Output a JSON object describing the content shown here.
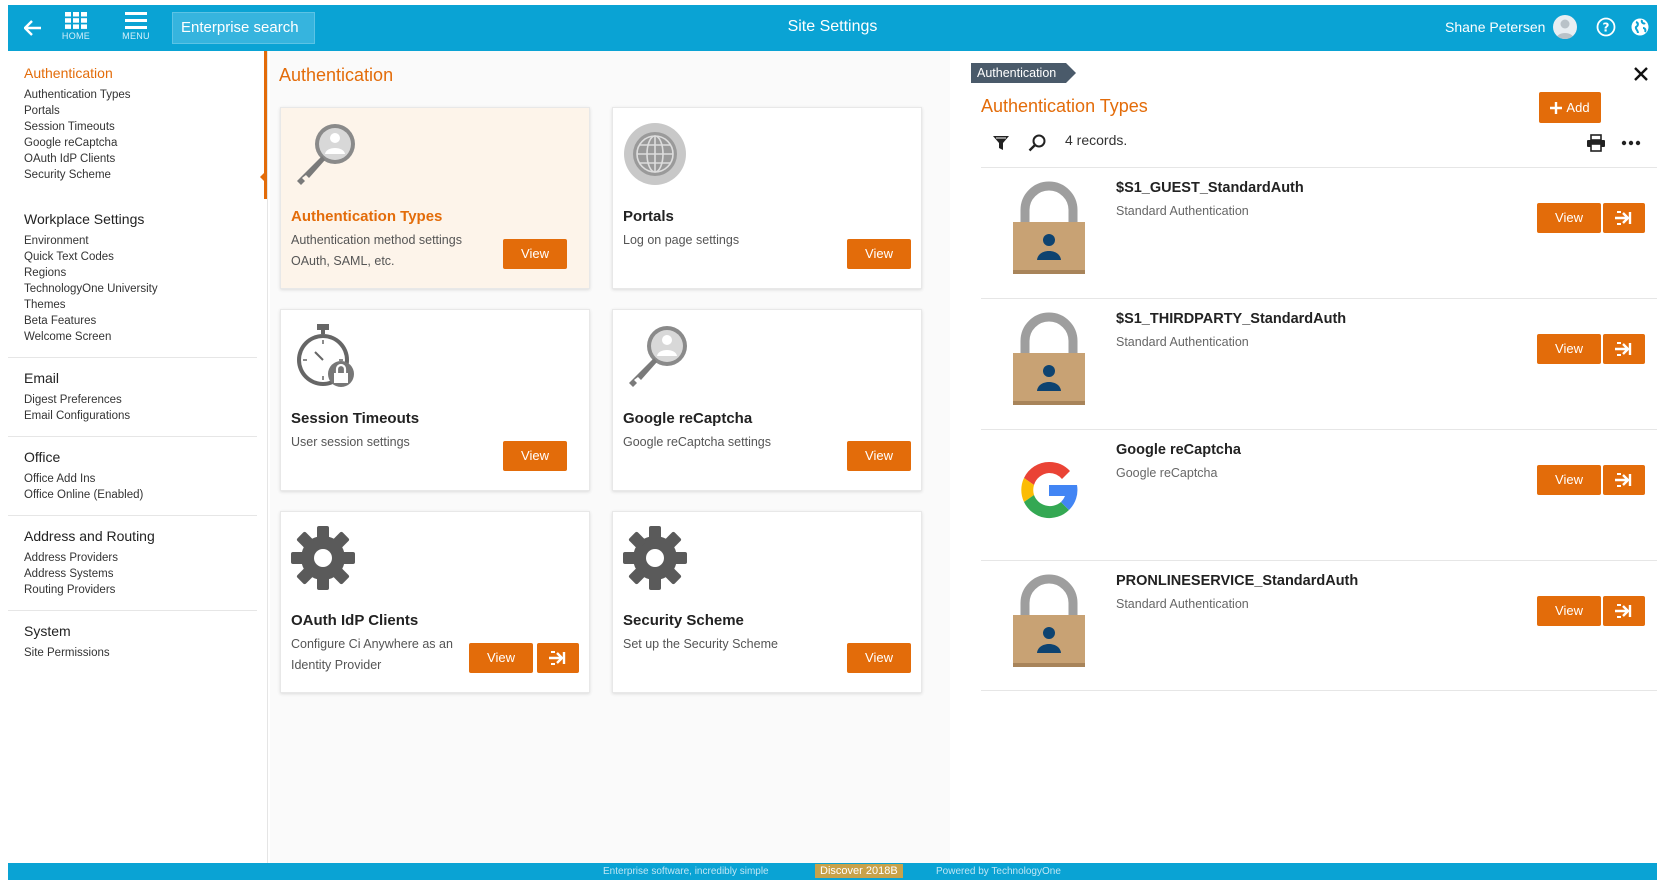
{
  "topbar": {
    "home_label": "HOME",
    "menu_label": "MENU",
    "search_placeholder": "Enterprise search",
    "title": "Site Settings",
    "user_name": "Shane Petersen"
  },
  "sidebar": {
    "groups": [
      {
        "heading": "Authentication",
        "items": [
          "Authentication Types",
          "Portals",
          "Session Timeouts",
          "Google reCaptcha",
          "OAuth IdP Clients",
          "Security Scheme"
        ]
      },
      {
        "heading": "Workplace Settings",
        "items": [
          "Environment",
          "Quick Text Codes",
          "Regions",
          "TechnologyOne University",
          "Themes",
          "Beta Features",
          "Welcome Screen"
        ]
      },
      {
        "heading": "Email",
        "items": [
          "Digest Preferences",
          "Email Configurations"
        ]
      },
      {
        "heading": "Office",
        "items": [
          "Office Add Ins",
          "Office Online (Enabled)"
        ]
      },
      {
        "heading": "Address and Routing",
        "items": [
          "Address Providers",
          "Address Systems",
          "Routing Providers"
        ]
      },
      {
        "heading": "System",
        "items": [
          "Site Permissions"
        ]
      }
    ]
  },
  "main": {
    "title": "Authentication",
    "cards": [
      {
        "title": "Authentication Types",
        "desc": "Authentication method settings OAuth, SAML, etc.",
        "icon": "key-user-icon",
        "button": "View"
      },
      {
        "title": "Portals",
        "desc": "Log on page settings",
        "icon": "globe-icon",
        "button": "View"
      },
      {
        "title": "Session Timeouts",
        "desc": "User session settings",
        "icon": "stopwatch-lock-icon",
        "button": "View"
      },
      {
        "title": "Google reCaptcha",
        "desc": "Google reCaptcha settings",
        "icon": "key-user-icon",
        "button": "View"
      },
      {
        "title": "OAuth IdP Clients",
        "desc": "Configure Ci Anywhere as an Identity Provider",
        "icon": "gear-icon",
        "button": "View"
      },
      {
        "title": "Security Scheme",
        "desc": "Set up the Security Scheme",
        "icon": "gear-icon",
        "button": "View"
      }
    ]
  },
  "panel": {
    "breadcrumb": "Authentication",
    "title": "Authentication Types",
    "add_label": "Add",
    "records": "4 records.",
    "items": [
      {
        "name": "$S1_GUEST_StandardAuth",
        "sub": "Standard Authentication",
        "icon": "padlock-user-icon",
        "button": "View"
      },
      {
        "name": "$S1_THIRDPARTY_StandardAuth",
        "sub": "Standard Authentication",
        "icon": "padlock-user-icon",
        "button": "View"
      },
      {
        "name": "Google reCaptcha",
        "sub": "Google reCaptcha",
        "icon": "google-g-icon",
        "button": "View"
      },
      {
        "name": "PRONLINESERVICE_StandardAuth",
        "sub": "Standard Authentication",
        "icon": "padlock-user-icon",
        "button": "View"
      }
    ]
  },
  "footer": {
    "tagline": "Enterprise software, incredibly simple",
    "version": "Discover 2018B",
    "powered": "Powered by TechnologyOne"
  },
  "colors": {
    "accent": "#e36c0a",
    "topbar": "#0aa3d4",
    "crumb": "#4a5a6a"
  }
}
